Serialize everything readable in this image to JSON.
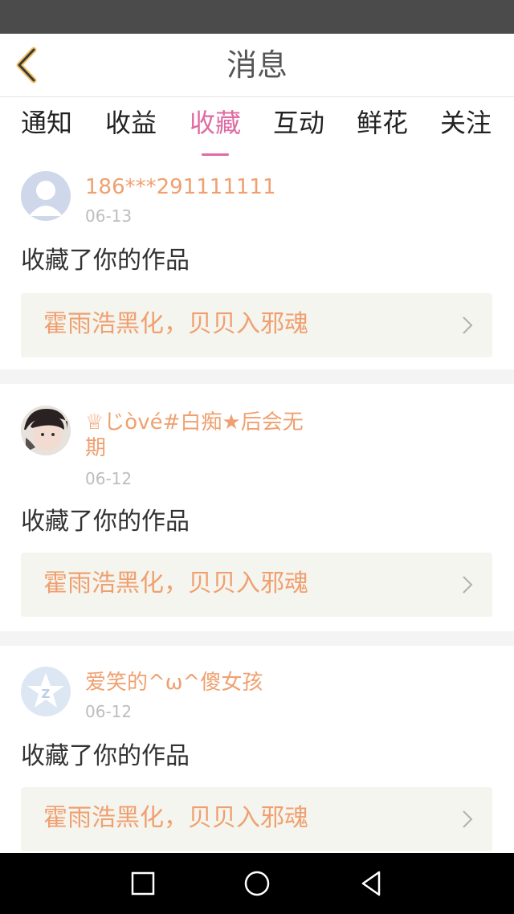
{
  "header": {
    "title": "消息"
  },
  "tabs": [
    {
      "label": "通知",
      "active": false
    },
    {
      "label": "收益",
      "active": false
    },
    {
      "label": "收藏",
      "active": true
    },
    {
      "label": "互动",
      "active": false
    },
    {
      "label": "鲜花",
      "active": false
    },
    {
      "label": "关注",
      "active": false
    }
  ],
  "messages": [
    {
      "name": "186***291111111",
      "date": "06-13",
      "action": "收藏了你的作品",
      "work": "霍雨浩黑化，贝贝入邪魂",
      "avatar": "default-avatar-icon"
    },
    {
      "name_line1": "♕じòvé#白痴★后会无",
      "name_line2": "期",
      "date": "06-12",
      "action": "收藏了你的作品",
      "work": "霍雨浩黑化，贝贝入邪魂",
      "avatar": "user-photo"
    },
    {
      "name": "爱笑的^ω^傻女孩",
      "date": "06-12",
      "action": "收藏了你的作品",
      "work": "霍雨浩黑化，贝贝入邪魂",
      "avatar": "qq-logo-icon"
    }
  ],
  "colors": {
    "accent": "#e06aa3",
    "highlight": "#f0a070",
    "status_bar": "#4b4b4b"
  }
}
